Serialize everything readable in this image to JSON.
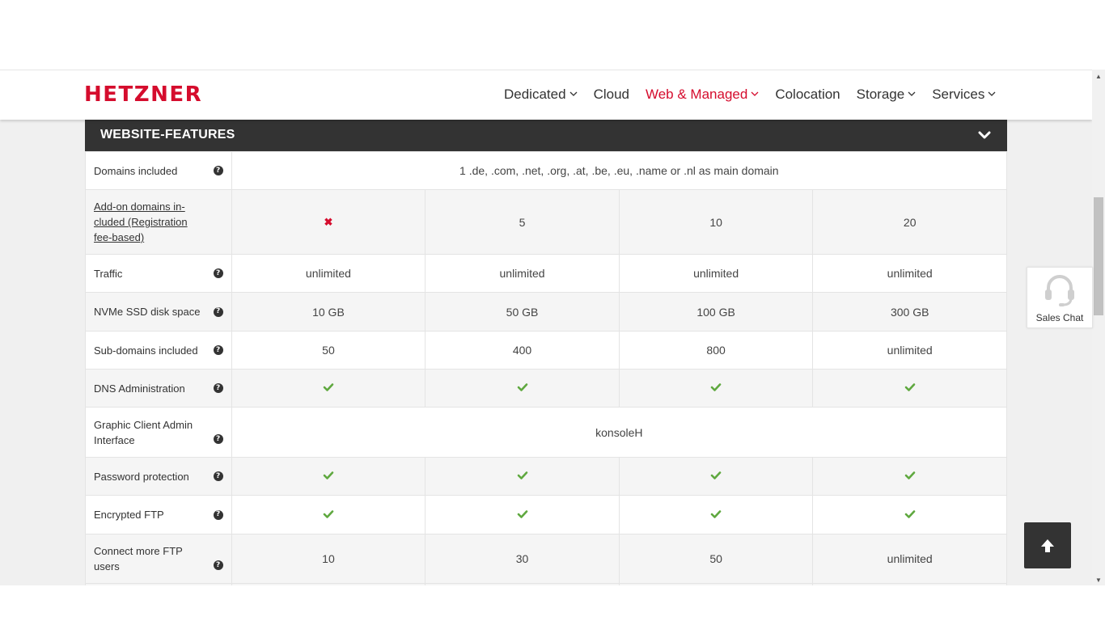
{
  "brand": {
    "logo_text": "HETZNER",
    "accent": "#d50c2d"
  },
  "nav": {
    "items": [
      {
        "label": "Dedicated",
        "dropdown": true,
        "active": false
      },
      {
        "label": "Cloud",
        "dropdown": false,
        "active": false
      },
      {
        "label": "Web & Managed",
        "dropdown": true,
        "active": true
      },
      {
        "label": "Colocation",
        "dropdown": false,
        "active": false
      },
      {
        "label": "Storage",
        "dropdown": true,
        "active": false
      },
      {
        "label": "Services",
        "dropdown": true,
        "active": false
      }
    ]
  },
  "section": {
    "title": "WEBSITE-FEATURES",
    "toggle_icon": "chevron-down-icon"
  },
  "rows": [
    {
      "label": "Domains included",
      "help": true,
      "span": "1 .de, .com, .net, .org, .at, .be, .eu, .name or .nl as main domain"
    },
    {
      "label": "Add-on domains in-cluded (Registration fee-based)",
      "link": true,
      "help": false,
      "values": [
        "cross",
        "5",
        "10",
        "20"
      ]
    },
    {
      "label": "Traffic",
      "help": true,
      "values": [
        "unlimited",
        "unlimited",
        "unlimited",
        "unlimited"
      ]
    },
    {
      "label": "NVMe SSD disk space",
      "help": true,
      "values": [
        "10 GB",
        "50 GB",
        "100 GB",
        "300 GB"
      ]
    },
    {
      "label": "Sub-domains included",
      "help": true,
      "values": [
        "50",
        "400",
        "800",
        "unlimited"
      ]
    },
    {
      "label": "DNS Administration",
      "help": true,
      "values": [
        "check",
        "check",
        "check",
        "check"
      ]
    },
    {
      "label": "Graphic Client Admin Interface",
      "help": true,
      "help_low": true,
      "span": "konsoleH"
    },
    {
      "label": "Password protection",
      "help": true,
      "values": [
        "check",
        "check",
        "check",
        "check"
      ]
    },
    {
      "label": "Encrypted FTP",
      "help": true,
      "values": [
        "check",
        "check",
        "check",
        "check"
      ]
    },
    {
      "label": "Connect more FTP users",
      "help": true,
      "help_low": true,
      "values": [
        "10",
        "30",
        "50",
        "unlimited"
      ]
    }
  ],
  "icons": {
    "help": "question-icon",
    "check": "check-icon",
    "cross": "cross-icon"
  },
  "colors": {
    "check": "#5fa83f",
    "cross": "#d50c2d",
    "section_bg": "#333333"
  },
  "sales_chat": {
    "label": "Sales Chat",
    "icon": "headset-icon"
  },
  "back_to_top": {
    "icon": "arrow-up-icon"
  },
  "help_glyph": "?"
}
